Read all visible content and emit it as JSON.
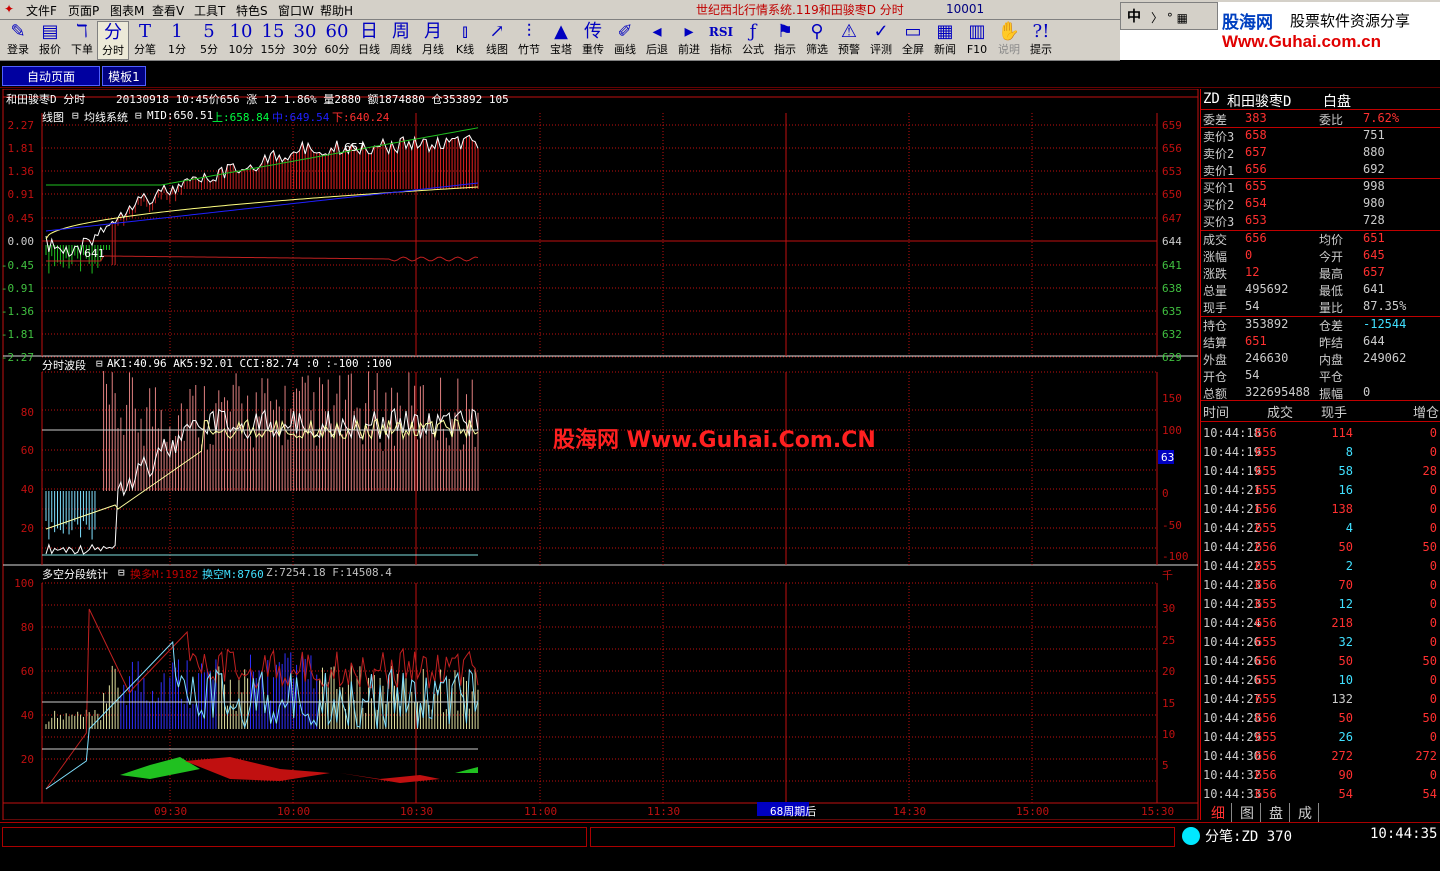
{
  "menu": [
    "文件F",
    "页面P",
    "图表M",
    "查看V",
    "工具T",
    "特色S",
    "窗口W",
    "帮助H"
  ],
  "window_title": "世纪西北行情系统.119和田骏枣D 分时",
  "window_code": "10001",
  "logo": {
    "brand": "股海网",
    "slogan": "股票软件资源分享",
    "url": "Www.Guhai.com.cn",
    "ime": "中",
    "ime_extra": "〉 ° ▦"
  },
  "toolbar": [
    {
      "label": "登录",
      "icon": "✎"
    },
    {
      "label": "报价",
      "icon": "▤"
    },
    {
      "label": "下单",
      "icon": "ℸ"
    },
    {
      "label": "分时",
      "icon": "分"
    },
    {
      "label": "分笔",
      "icon": "T"
    },
    {
      "label": "1分",
      "icon": "1"
    },
    {
      "label": "5分",
      "icon": "5"
    },
    {
      "label": "10分",
      "icon": "10"
    },
    {
      "label": "15分",
      "icon": "15"
    },
    {
      "label": "30分",
      "icon": "30"
    },
    {
      "label": "60分",
      "icon": "60"
    },
    {
      "label": "日线",
      "icon": "日"
    },
    {
      "label": "周线",
      "icon": "周"
    },
    {
      "label": "月线",
      "icon": "月"
    },
    {
      "label": "K线",
      "icon": "⫾"
    },
    {
      "label": "线图",
      "icon": "↗"
    },
    {
      "label": "竹节",
      "icon": "⫶"
    },
    {
      "label": "宝塔",
      "icon": "▲"
    },
    {
      "label": "重传",
      "icon": "传"
    },
    {
      "label": "画线",
      "icon": "✐"
    },
    {
      "label": "后退",
      "icon": "◂"
    },
    {
      "label": "前进",
      "icon": "▸"
    },
    {
      "label": "指标",
      "icon": "RSI"
    },
    {
      "label": "公式",
      "icon": "ƒ"
    },
    {
      "label": "指示",
      "icon": "⚑"
    },
    {
      "label": "筛选",
      "icon": "⚲"
    },
    {
      "label": "预警",
      "icon": "⚠"
    },
    {
      "label": "评测",
      "icon": "✓"
    },
    {
      "label": "全屏",
      "icon": "▭"
    },
    {
      "label": "新闻",
      "icon": "▦"
    },
    {
      "label": "F10",
      "icon": "▥"
    },
    {
      "label": "说明",
      "icon": "✋"
    },
    {
      "label": "提示",
      "icon": "?!"
    }
  ],
  "tabs": [
    "自动页面",
    "模板1"
  ],
  "panel1": {
    "title": "和田骏枣D 分时",
    "info": "20130918 10:45价656 涨 12 1.86% 量2880 额1874880 仓353892 105",
    "ind_name": "线图",
    "ind_name2": "均线系统",
    "mid": "MID:650.51",
    "up": "上:658.84",
    "midv": "中:649.54",
    "down": "下:640.24",
    "left_ticks": [
      "2.27",
      "1.81",
      "1.36",
      "0.91",
      "0.45",
      "0.00",
      "-0.45",
      "-0.91",
      "-1.36",
      "-1.81",
      "-2.27"
    ],
    "right_ticks": [
      "659",
      "656",
      "653",
      "650",
      "647",
      "644",
      "641",
      "638",
      "635",
      "632",
      "629"
    ],
    "mark_hi": "657",
    "mark_lo": "641"
  },
  "panel2": {
    "name": "分时波段",
    "params": "AK1:40.96 AK5:92.01 CCI:82.74 :0 :-100 :100",
    "left_ticks": [
      "80",
      "60",
      "40",
      "20"
    ],
    "right_ticks": [
      "150",
      "100",
      "50",
      "0",
      "-50",
      "-100"
    ],
    "badge": "63"
  },
  "panel3": {
    "name": "多空分段统计",
    "p1": "换多M:19182",
    "p2": "换空M:8760",
    "p3": "Z:7254.18 F:14508.4",
    "left_ticks": [
      "100",
      "80",
      "60",
      "40",
      "20"
    ],
    "right_ticks": [
      "千",
      "30",
      "25",
      "20",
      "15",
      "10",
      "5"
    ]
  },
  "time_ticks": [
    "09:30",
    "10:00",
    "10:30",
    "11:00",
    "11:30",
    "68周期后",
    "14:30",
    "15:00",
    "15:30"
  ],
  "watermark": "股海网 Www.Guhai.Com.CN",
  "quote": {
    "header": {
      "code": "ZD",
      "name": "和田骏枣D",
      "type": "白盘"
    },
    "weicha": {
      "label": "委差",
      "value": "383",
      "label2": "委比",
      "value2": "7.62%"
    },
    "asks": [
      {
        "label": "卖价3",
        "price": "658",
        "vol": "751"
      },
      {
        "label": "卖价2",
        "price": "657",
        "vol": "880"
      },
      {
        "label": "卖价1",
        "price": "656",
        "vol": "692"
      }
    ],
    "bids": [
      {
        "label": "买价1",
        "price": "655",
        "vol": "998"
      },
      {
        "label": "买价2",
        "price": "654",
        "vol": "980"
      },
      {
        "label": "买价3",
        "price": "653",
        "vol": "728"
      }
    ],
    "stats1": [
      {
        "l1": "成交",
        "v1": "656",
        "l2": "均价",
        "v2": "651"
      },
      {
        "l1": "涨幅",
        "v1": "0",
        "l2": "今开",
        "v2": "645"
      },
      {
        "l1": "涨跌",
        "v1": "12",
        "l2": "最高",
        "v2": "657"
      },
      {
        "l1": "总量",
        "v1": "495692",
        "l2": "最低",
        "v2": "641"
      },
      {
        "l1": "现手",
        "v1": "54",
        "l2": "量比",
        "v2": "87.35%"
      }
    ],
    "stats2": [
      {
        "l1": "持仓",
        "v1": "353892",
        "l2": "仓差",
        "v2": "-12544"
      },
      {
        "l1": "结算",
        "v1": "651",
        "l2": "昨结",
        "v2": "644"
      },
      {
        "l1": "外盘",
        "v1": "246630",
        "l2": "内盘",
        "v2": "249062"
      },
      {
        "l1": "开仓",
        "v1": "54",
        "l2": "平仓",
        "v2": ""
      },
      {
        "l1": "总额",
        "v1": "322695488",
        "l2": "振幅",
        "v2": "0"
      }
    ],
    "trade_header": [
      "时间",
      "成交",
      "现手",
      "增仓"
    ],
    "trades": [
      [
        "10:44:18",
        "656",
        "114",
        "0"
      ],
      [
        "10:44:19",
        "655",
        "8",
        "0"
      ],
      [
        "10:44:19",
        "655",
        "58",
        "28"
      ],
      [
        "10:44:21",
        "655",
        "16",
        "0"
      ],
      [
        "10:44:21",
        "656",
        "138",
        "0"
      ],
      [
        "10:44:22",
        "655",
        "4",
        "0"
      ],
      [
        "10:44:22",
        "656",
        "50",
        "50"
      ],
      [
        "10:44:22",
        "655",
        "2",
        "0"
      ],
      [
        "10:44:23",
        "656",
        "70",
        "0"
      ],
      [
        "10:44:23",
        "655",
        "12",
        "0"
      ],
      [
        "10:44:24",
        "656",
        "218",
        "0"
      ],
      [
        "10:44:26",
        "655",
        "32",
        "0"
      ],
      [
        "10:44:26",
        "656",
        "50",
        "50"
      ],
      [
        "10:44:26",
        "655",
        "10",
        "0"
      ],
      [
        "10:44:27",
        "655",
        "132",
        "0"
      ],
      [
        "10:44:28",
        "656",
        "50",
        "50"
      ],
      [
        "10:44:29",
        "655",
        "26",
        "0"
      ],
      [
        "10:44:30",
        "656",
        "272",
        "272"
      ],
      [
        "10:44:32",
        "656",
        "90",
        "0"
      ],
      [
        "10:44:33",
        "656",
        "54",
        "54"
      ]
    ],
    "bottom_tabs": [
      "细",
      "图",
      "盘",
      "成"
    ]
  },
  "status": {
    "text": "分笔:ZD 370",
    "time": "10:44:35"
  }
}
